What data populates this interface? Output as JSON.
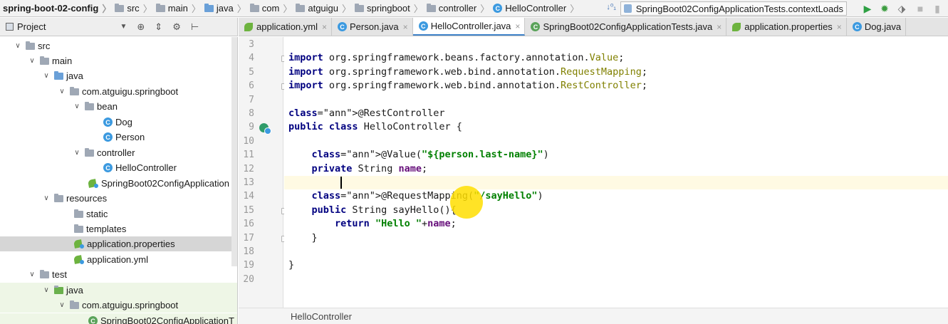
{
  "navbar": {
    "crumbs": [
      {
        "label": "spring-boot-02-config",
        "icon": "none"
      },
      {
        "label": "src",
        "icon": "folder-icon"
      },
      {
        "label": "main",
        "icon": "folder-icon"
      },
      {
        "label": "java",
        "icon": "source-folder-icon"
      },
      {
        "label": "com",
        "icon": "package-icon"
      },
      {
        "label": "atguigu",
        "icon": "package-icon"
      },
      {
        "label": "springboot",
        "icon": "package-icon"
      },
      {
        "label": "controller",
        "icon": "package-icon"
      },
      {
        "label": "HelloController",
        "icon": "class-icon"
      }
    ],
    "run_config": "SpringBoot02ConfigApplicationTests.contextLoads",
    "colors": {
      "run": "#2ea043",
      "debug": "#3d9d41",
      "accent": "#4083c9"
    }
  },
  "project_panel": {
    "title": "Project",
    "tree": [
      {
        "label": "src",
        "icon": "folder-icon",
        "arrow": "expanded"
      },
      {
        "label": "main",
        "icon": "folder-icon",
        "arrow": "expanded"
      },
      {
        "label": "java",
        "icon": "source-folder-icon",
        "arrow": "expanded"
      },
      {
        "label": "com.atguigu.springboot",
        "icon": "package-icon",
        "arrow": "expanded"
      },
      {
        "label": "bean",
        "icon": "package-icon",
        "arrow": "expanded"
      },
      {
        "label": "Dog",
        "icon": "class-icon",
        "arrow": "none"
      },
      {
        "label": "Person",
        "icon": "class-icon",
        "arrow": "none"
      },
      {
        "label": "controller",
        "icon": "package-icon",
        "arrow": "expanded"
      },
      {
        "label": "HelloController",
        "icon": "class-icon",
        "arrow": "none"
      },
      {
        "label": "SpringBoot02ConfigApplication",
        "icon": "spring-app-icon",
        "arrow": "none"
      },
      {
        "label": "resources",
        "icon": "resources-folder-icon",
        "arrow": "expanded"
      },
      {
        "label": "static",
        "icon": "folder-icon",
        "arrow": "none"
      },
      {
        "label": "templates",
        "icon": "folder-icon",
        "arrow": "none"
      },
      {
        "label": "application.properties",
        "icon": "spring-config-icon",
        "arrow": "none",
        "selected": true
      },
      {
        "label": "application.yml",
        "icon": "spring-config-icon",
        "arrow": "none"
      },
      {
        "label": "test",
        "icon": "folder-icon",
        "arrow": "expanded"
      },
      {
        "label": "java",
        "icon": "test-folder-icon",
        "arrow": "expanded"
      },
      {
        "label": "com.atguigu.springboot",
        "icon": "package-icon",
        "arrow": "expanded"
      },
      {
        "label": "SpringBoot02ConfigApplicationT",
        "icon": "test-class-icon",
        "arrow": "none"
      }
    ]
  },
  "tabs": [
    {
      "label": "application.yml",
      "icon": "spring-config-icon",
      "active": false
    },
    {
      "label": "Person.java",
      "icon": "class-icon",
      "active": false
    },
    {
      "label": "HelloController.java",
      "icon": "class-icon",
      "active": true
    },
    {
      "label": "SpringBoot02ConfigApplicationTests.java",
      "icon": "test-class-icon",
      "active": false
    },
    {
      "label": "application.properties",
      "icon": "spring-config-icon",
      "active": false
    },
    {
      "label": "Dog.java",
      "icon": "class-icon",
      "active": false
    }
  ],
  "editor": {
    "lines": [
      {
        "num": "3",
        "text": ""
      },
      {
        "num": "4",
        "text": "import org.springframework.beans.factory.annotation.Value;"
      },
      {
        "num": "5",
        "text": "import org.springframework.web.bind.annotation.RequestMapping;"
      },
      {
        "num": "6",
        "text": "import org.springframework.web.bind.annotation.RestController;"
      },
      {
        "num": "7",
        "text": ""
      },
      {
        "num": "8",
        "text": "@RestController"
      },
      {
        "num": "9",
        "text": "public class HelloController {"
      },
      {
        "num": "10",
        "text": ""
      },
      {
        "num": "11",
        "text": "    @Value(\"${person.last-name}\")"
      },
      {
        "num": "12",
        "text": "    private String name;"
      },
      {
        "num": "13",
        "text": ""
      },
      {
        "num": "14",
        "text": "    @RequestMapping(\"/sayHello\")"
      },
      {
        "num": "15",
        "text": "    public String sayHello(){"
      },
      {
        "num": "16",
        "text": "        return \"Hello \"+name;"
      },
      {
        "num": "17",
        "text": "    }"
      },
      {
        "num": "18",
        "text": ""
      },
      {
        "num": "19",
        "text": "}"
      },
      {
        "num": "20",
        "text": ""
      }
    ]
  },
  "footer_breadcrumb": "HelloController"
}
